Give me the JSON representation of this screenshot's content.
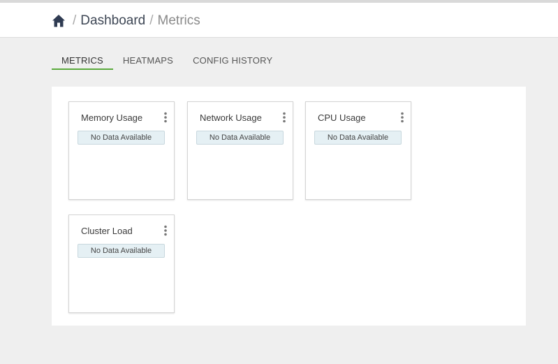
{
  "breadcrumb": {
    "home_icon": "home-icon",
    "separator": "/",
    "items": [
      {
        "label": "Dashboard"
      },
      {
        "label": "Metrics"
      }
    ]
  },
  "tabs": [
    {
      "label": "METRICS",
      "active": true
    },
    {
      "label": "HEATMAPS",
      "active": false
    },
    {
      "label": "CONFIG HISTORY",
      "active": false
    }
  ],
  "widgets": [
    {
      "title": "Memory Usage",
      "status": "No Data Available"
    },
    {
      "title": "Network Usage",
      "status": "No Data Available"
    },
    {
      "title": "CPU Usage",
      "status": "No Data Available"
    },
    {
      "title": "Cluster Load",
      "status": "No Data Available"
    }
  ],
  "colors": {
    "accent_tab_underline": "#5aaa3c",
    "home_icon": "#2f3b52",
    "no_data_bg": "#e5f0f4"
  }
}
